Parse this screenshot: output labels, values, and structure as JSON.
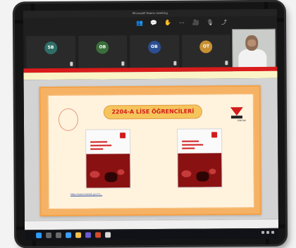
{
  "window": {
    "title": "Microsoft Teams meeting"
  },
  "toolbar": [
    {
      "icon": "people-icon"
    },
    {
      "icon": "chat-icon"
    },
    {
      "icon": "hand-icon"
    },
    {
      "icon": "more-icon"
    },
    {
      "icon": "camera-icon"
    },
    {
      "icon": "mic-icon"
    },
    {
      "icon": "share-icon"
    }
  ],
  "participants": [
    {
      "initials": "SB",
      "name": "",
      "color": "#2f6f67"
    },
    {
      "initials": "OB",
      "name": "",
      "color": "#3a6f3b"
    },
    {
      "initials": "OB",
      "name": "",
      "color": "#2c4f93"
    },
    {
      "initials": "OT",
      "name": "",
      "color": "#c79032"
    }
  ],
  "slide": {
    "title": "2204-A LİSE ÖĞRENCİLERİ",
    "logo_label": "TÜBİTAK",
    "url": "https://www.tubitak.gov.tr/..."
  },
  "slides_footer": {
    "text": ""
  },
  "taskbar": {
    "apps": [
      {
        "icon": "windows-start-icon",
        "color": "#2f9cff"
      },
      {
        "icon": "search-icon",
        "color": "#666"
      },
      {
        "icon": "task-view-icon",
        "color": "#6a6a6a"
      },
      {
        "icon": "edge-icon",
        "color": "#3aa0ff"
      },
      {
        "icon": "file-explorer-icon",
        "color": "#f2c04b"
      },
      {
        "icon": "teams-icon",
        "color": "#6b5bd3"
      },
      {
        "icon": "powerpoint-icon",
        "color": "#d24b2a"
      },
      {
        "icon": "chrome-icon",
        "color": "#d7d7d7"
      }
    ],
    "clock": ""
  }
}
